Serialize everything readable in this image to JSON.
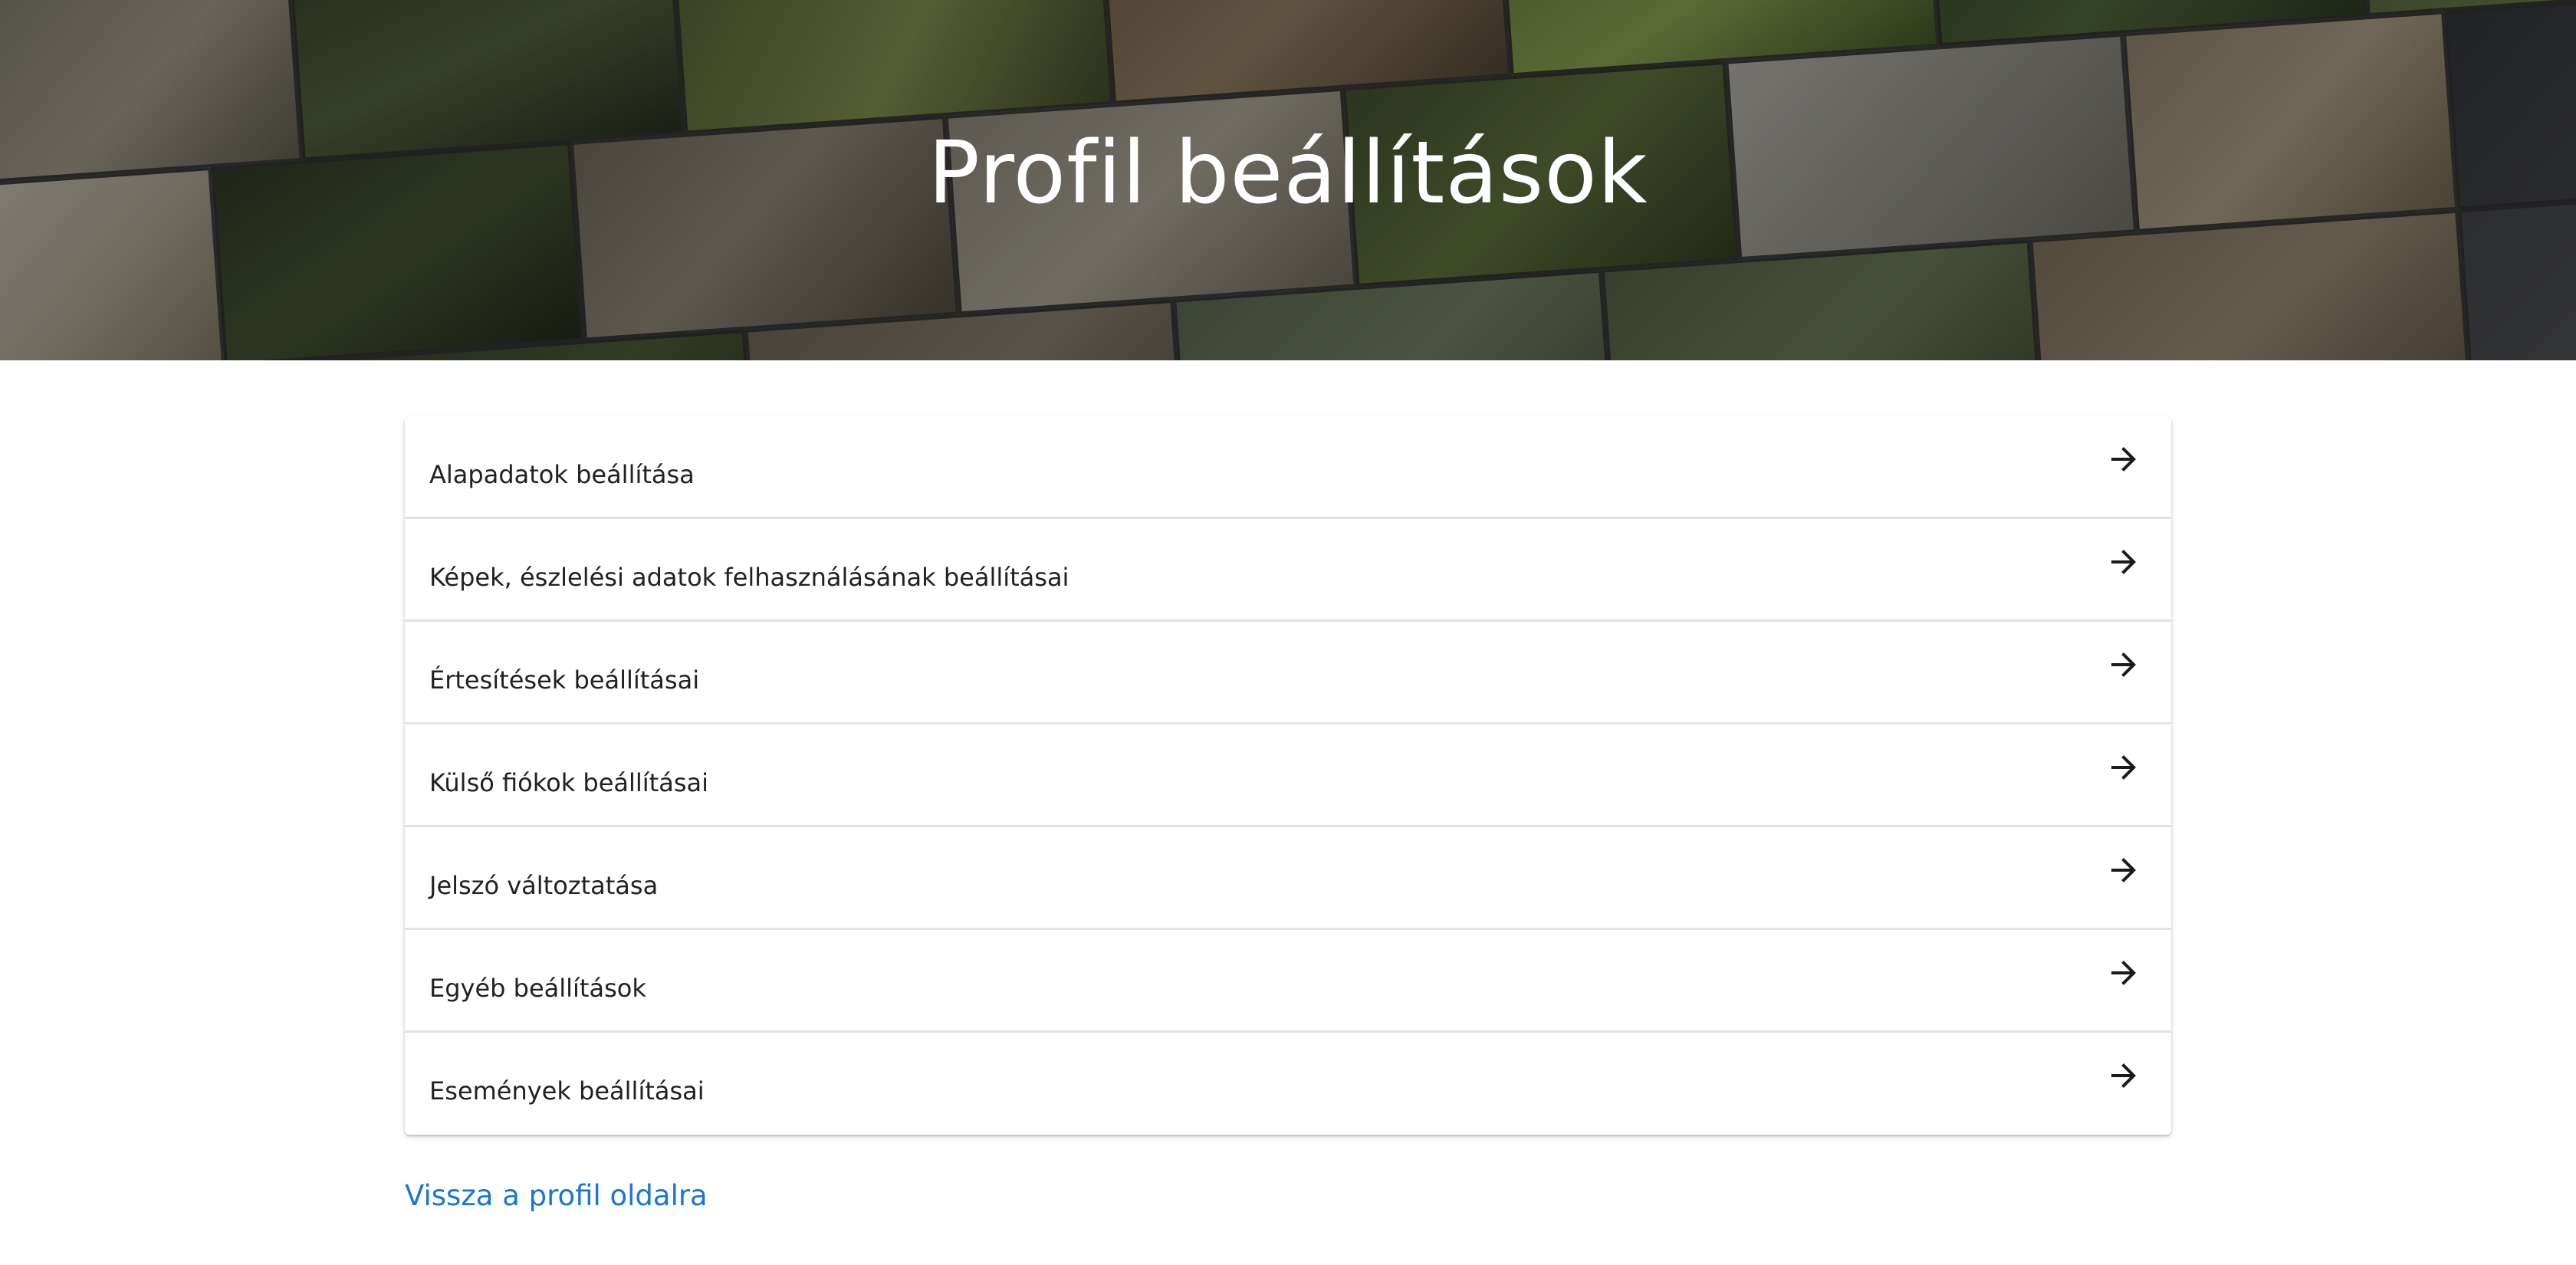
{
  "page": {
    "title": "Profil beállítások"
  },
  "hero": {
    "image": "insect-photo-mosaic"
  },
  "settings": {
    "items": [
      {
        "label": "Alapadatok beállítása",
        "icon": "arrow-right-icon"
      },
      {
        "label": "Képek, észlelési adatok felhasználásának beállításai",
        "icon": "arrow-right-icon"
      },
      {
        "label": "Értesítések beállításai",
        "icon": "arrow-right-icon"
      },
      {
        "label": "Külső fiókok beállításai",
        "icon": "arrow-right-icon"
      },
      {
        "label": "Jelszó változtatása",
        "icon": "arrow-right-icon"
      },
      {
        "label": "Egyéb beállítások",
        "icon": "arrow-right-icon"
      },
      {
        "label": "Események beállításai",
        "icon": "arrow-right-icon"
      }
    ]
  },
  "footer": {
    "back_link": "Vissza a profil oldalra"
  },
  "colors": {
    "link": "#1976d2",
    "text": "#212121",
    "divider": "#e2e2e2",
    "hero_title": "#ffffff"
  }
}
